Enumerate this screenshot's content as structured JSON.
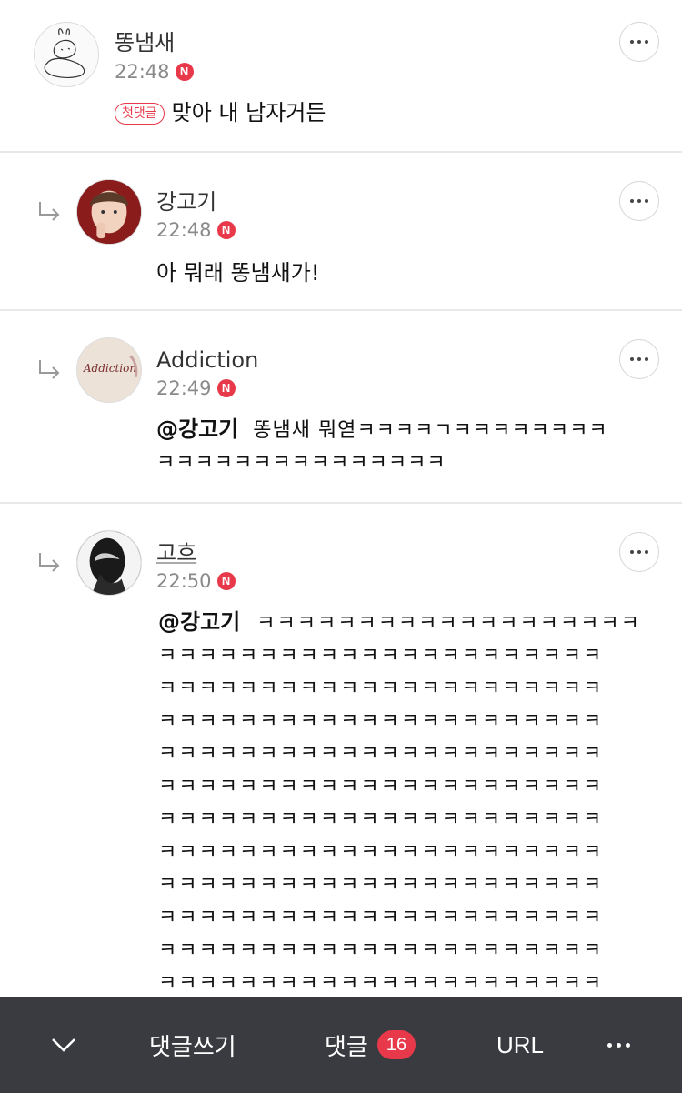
{
  "comments": [
    {
      "author": "똥냄새",
      "time": "22:48",
      "badge": "N",
      "first_label": "첫댓글",
      "text": "맞아 내 남자거든"
    },
    {
      "author": "강고기",
      "time": "22:48",
      "badge": "N",
      "text": "아 뭐래 똥냄새가!"
    },
    {
      "author": "Addiction",
      "time": "22:49",
      "badge": "N",
      "avatar_text": "Addiction",
      "mention": "@강고기",
      "text_line1": "똥냄새 뭐엳ㅋㅋㅋㅋㄱㅋㅋㅋㅋㅋㅋㅋㅋ",
      "text_line2": "ㅋㅋㅋㅋㅋㅋㅋㅋㅋㅋㅋㅋㅋㅋㅋ"
    },
    {
      "author": "고흐",
      "time": "22:50",
      "badge": "N",
      "mention": "@강고기",
      "first_line": "ㅋㅋㅋㅋㅋㅋㅋㅋㅋㅋㅋㅋㅋㅋㅋㅋㅋㅋㅋ",
      "lines": [
        "ㅋㅋㅋㅋㅋㅋㅋㅋㅋㅋㅋㅋㅋㅋㅋㅋㅋㅋㅋㅋㅋㅋ",
        "ㅋㅋㅋㅋㅋㅋㅋㅋㅋㅋㅋㅋㅋㅋㅋㅋㅋㅋㅋㅋㅋㅋ",
        "ㅋㅋㅋㅋㅋㅋㅋㅋㅋㅋㅋㅋㅋㅋㅋㅋㅋㅋㅋㅋㅋㅋ",
        "ㅋㅋㅋㅋㅋㅋㅋㅋㅋㅋㅋㅋㅋㅋㅋㅋㅋㅋㅋㅋㅋㅋ",
        "ㅋㅋㅋㅋㅋㅋㅋㅋㅋㅋㅋㅋㅋㅋㅋㅋㅋㅋㅋㅋㅋㅋ",
        "ㅋㅋㅋㅋㅋㅋㅋㅋㅋㅋㅋㅋㅋㅋㅋㅋㅋㅋㅋㅋㅋㅋ",
        "ㅋㅋㅋㅋㅋㅋㅋㅋㅋㅋㅋㅋㅋㅋㅋㅋㅋㅋㅋㅋㅋㅋ",
        "ㅋㅋㅋㅋㅋㅋㅋㅋㅋㅋㅋㅋㅋㅋㅋㅋㅋㅋㅋㅋㅋㅋ",
        "ㅋㅋㅋㅋㅋㅋㅋㅋㅋㅋㅋㅋㅋㅋㅋㅋㅋㅋㅋㅋㅋㅋ",
        "ㅋㅋㅋㅋㅋㅋㅋㅋㅋㅋㅋㅋㅋㅋㅋㅋㅋㅋㅋㅋㅋㅋ",
        "ㅋㅋㅋㅋㅋㅋㅋㅋㅋㅋㅋㅋㅋㅋㅋㅋㅋㅋㅋㅋㅋㅋ"
      ]
    }
  ],
  "bottom_bar": {
    "write_label": "댓글쓰기",
    "comments_label": "댓글",
    "comments_count": "16",
    "url_label": "URL"
  },
  "colors": {
    "accent": "#e8394a",
    "bar_bg": "#3a3b40"
  },
  "icons": [
    "reply-arrow-icon",
    "more-options-icon",
    "chevron-down-icon"
  ]
}
